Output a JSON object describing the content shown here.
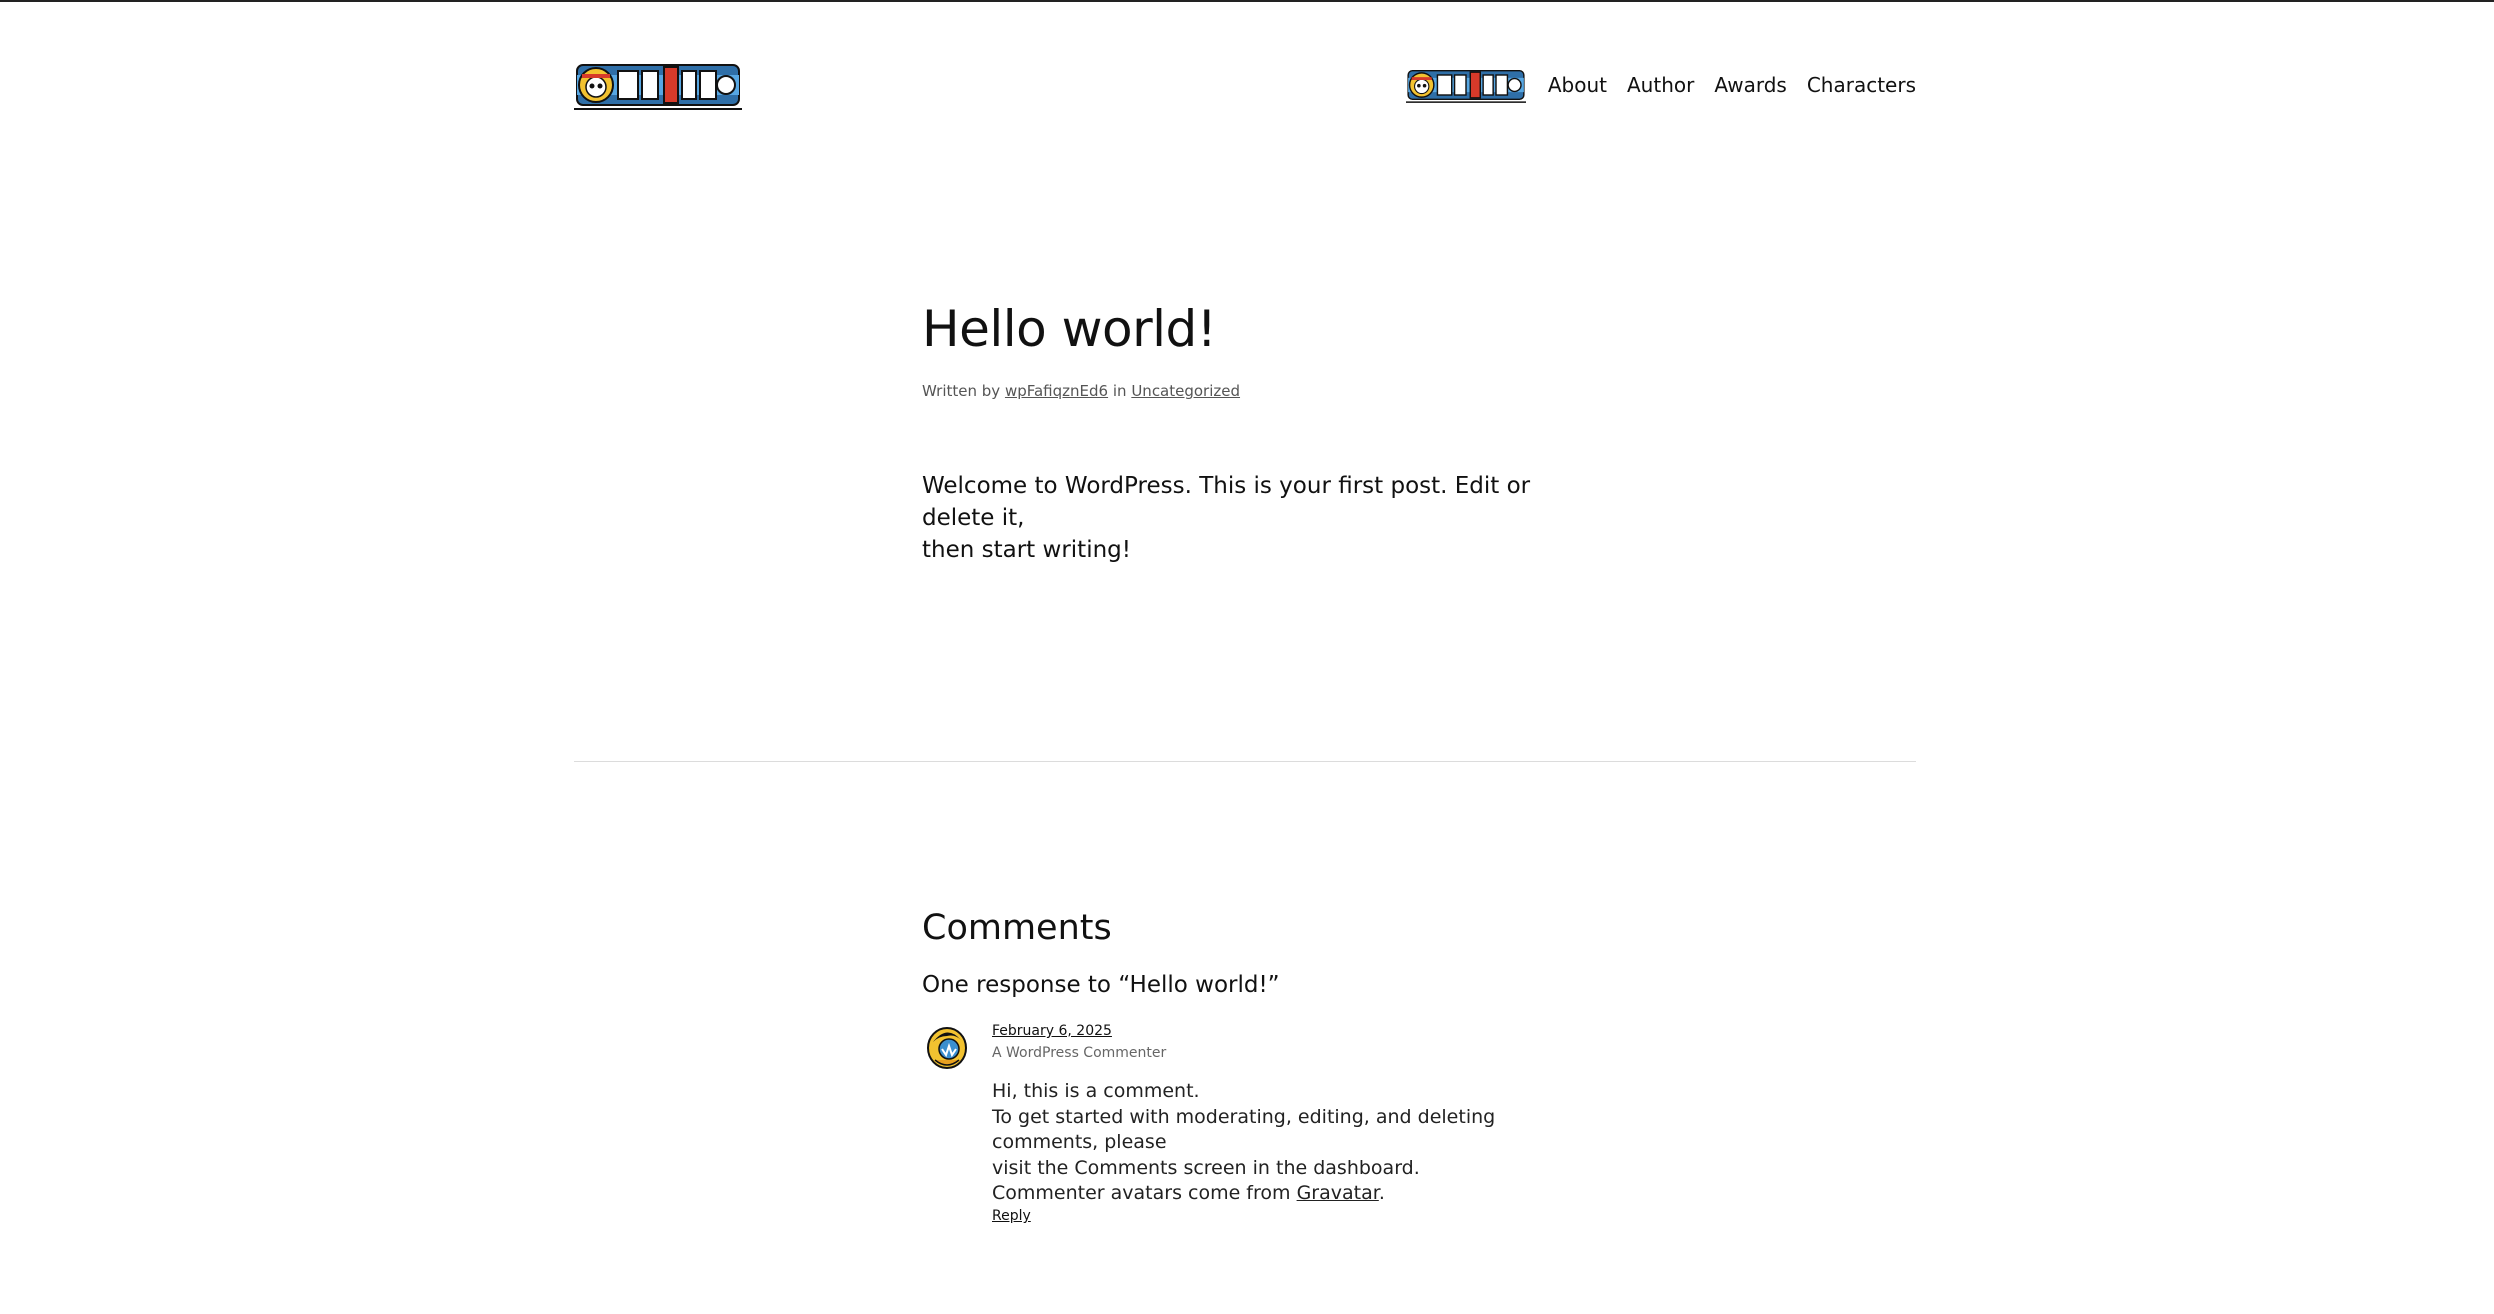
{
  "header": {
    "nav": {
      "items": [
        {
          "label": "About"
        },
        {
          "label": "Author"
        },
        {
          "label": "Awards"
        },
        {
          "label": "Characters"
        }
      ]
    }
  },
  "post": {
    "title": "Hello world!",
    "meta": {
      "written_by": "Written by",
      "author": "wpFafiqznEd6",
      "in": "in",
      "category": "Uncategorized"
    },
    "body_line1": "Welcome to WordPress. This is your first post. Edit or delete it,",
    "body_line2": "then start writing!"
  },
  "comments": {
    "heading": "Comments",
    "responses_title": "One response to “Hello world!”",
    "items": [
      {
        "date": "February 6, 2025",
        "author": "A WordPress Commenter",
        "line1": "Hi, this is a comment.",
        "line2": "To get started with moderating, editing, and deleting comments, please",
        "line3": "visit the Comments screen in the dashboard.",
        "line4_prefix": "Commenter avatars come from ",
        "line4_link": "Gravatar",
        "line4_suffix": ".",
        "reply": "Reply"
      }
    ]
  },
  "colors": {
    "logo_blue": "#3a8fcf",
    "logo_red": "#d63a2a",
    "logo_yellow": "#f2c230",
    "text": "#111111",
    "divider": "#dcdcdc"
  },
  "icons": {
    "site_logo": "one-piece-logo-icon",
    "avatar": "wordpress-commenter-avatar-icon"
  }
}
